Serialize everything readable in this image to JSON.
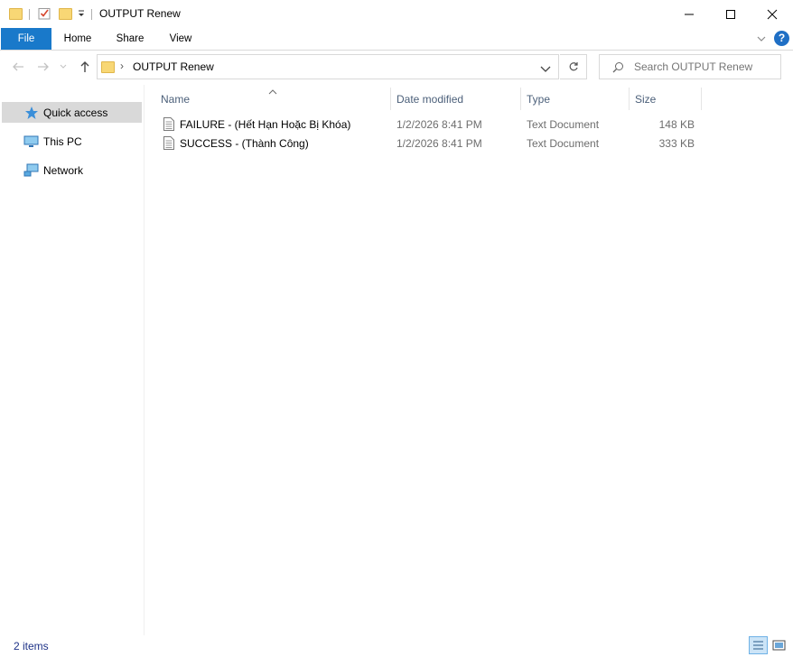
{
  "window": {
    "title": "OUTPUT Renew",
    "minimize_glyph": "—",
    "maximize_glyph": "☐",
    "close_glyph": "✕"
  },
  "ribbon": {
    "tabs": [
      {
        "label": "File",
        "active": true
      },
      {
        "label": "Home"
      },
      {
        "label": "Share"
      },
      {
        "label": "View"
      }
    ],
    "help_glyph": "?"
  },
  "address": {
    "path_separator": "›",
    "current_folder": "OUTPUT Renew",
    "search_placeholder": "Search OUTPUT Renew"
  },
  "nav": {
    "items": [
      {
        "label": "Quick access",
        "icon": "star-icon",
        "selected": true
      },
      {
        "label": "This PC",
        "icon": "monitor-icon"
      },
      {
        "label": "Network",
        "icon": "network-icon"
      }
    ]
  },
  "columns": {
    "name": "Name",
    "date": "Date modified",
    "type": "Type",
    "size": "Size"
  },
  "files": [
    {
      "name": "FAILURE - (Hết Hạn Hoặc Bị Khóa)",
      "date": "1/2/2026 8:41 PM",
      "type": "Text Document",
      "size": "148 KB"
    },
    {
      "name": "SUCCESS - (Thành Công)",
      "date": "1/2/2026 8:41 PM",
      "type": "Text Document",
      "size": "333 KB"
    }
  ],
  "status": {
    "item_count": "2 items"
  },
  "colors": {
    "file_tab": "#1979ca",
    "selected_nav": "#d9d9d9",
    "header_text": "#4c607a",
    "folder_yellow": "#f8d775"
  }
}
